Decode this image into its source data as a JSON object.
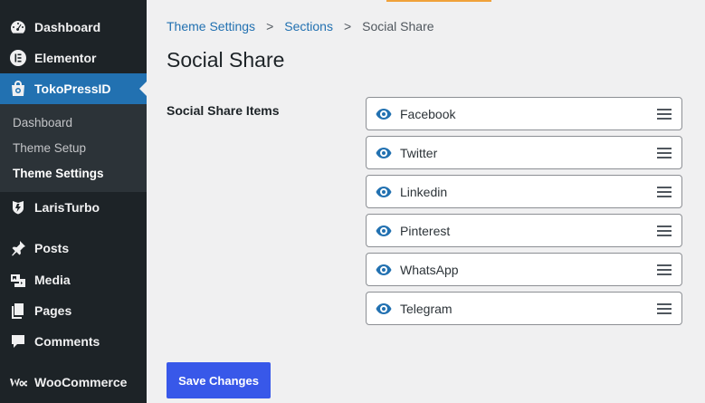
{
  "sidebar": {
    "items": [
      {
        "label": "Dashboard",
        "icon": "dashboard-icon"
      },
      {
        "label": "Elementor",
        "icon": "elementor-icon"
      },
      {
        "label": "TokoPressID",
        "icon": "shopping-bag-icon"
      },
      {
        "label": "LarisTurbo",
        "icon": "turbo-icon"
      },
      {
        "label": "Posts",
        "icon": "pin-icon"
      },
      {
        "label": "Media",
        "icon": "media-icon"
      },
      {
        "label": "Pages",
        "icon": "pages-icon"
      },
      {
        "label": "Comments",
        "icon": "comment-icon"
      },
      {
        "label": "WooCommerce",
        "icon": "woocommerce-icon"
      }
    ],
    "submenu": [
      {
        "label": "Dashboard"
      },
      {
        "label": "Theme Setup"
      },
      {
        "label": "Theme Settings"
      }
    ]
  },
  "breadcrumb": {
    "items": [
      "Theme Settings",
      "Sections"
    ],
    "current": "Social Share",
    "separator": ">"
  },
  "page": {
    "title": "Social Share",
    "field_label": "Social Share Items"
  },
  "share_items": [
    {
      "label": "Facebook"
    },
    {
      "label": "Twitter"
    },
    {
      "label": "Linkedin"
    },
    {
      "label": "Pinterest"
    },
    {
      "label": "WhatsApp"
    },
    {
      "label": "Telegram"
    }
  ],
  "actions": {
    "save_label": "Save Changes"
  },
  "colors": {
    "sidebar_bg": "#1d2327",
    "active": "#2271b1",
    "button": "#3858e9",
    "accent": "#f0a23b"
  }
}
